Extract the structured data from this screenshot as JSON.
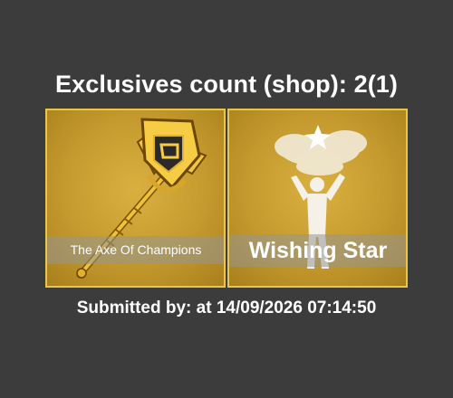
{
  "header": {
    "label": "Exclusives count (shop):",
    "count": "2(1)"
  },
  "items": [
    {
      "name": "The Axe Of Champions",
      "icon": "golden-axe-icon"
    },
    {
      "name": "Wishing Star",
      "icon": "wishing-star-emote-icon"
    }
  ],
  "footer": {
    "submitted_label": "Submitted by:",
    "submitter": "",
    "at_label": "at",
    "timestamp": "14/09/2026 07:14:50"
  },
  "colors": {
    "background": "#3c3c3c",
    "card_border": "#e8c64a",
    "card_gold": "#c49a2e"
  }
}
